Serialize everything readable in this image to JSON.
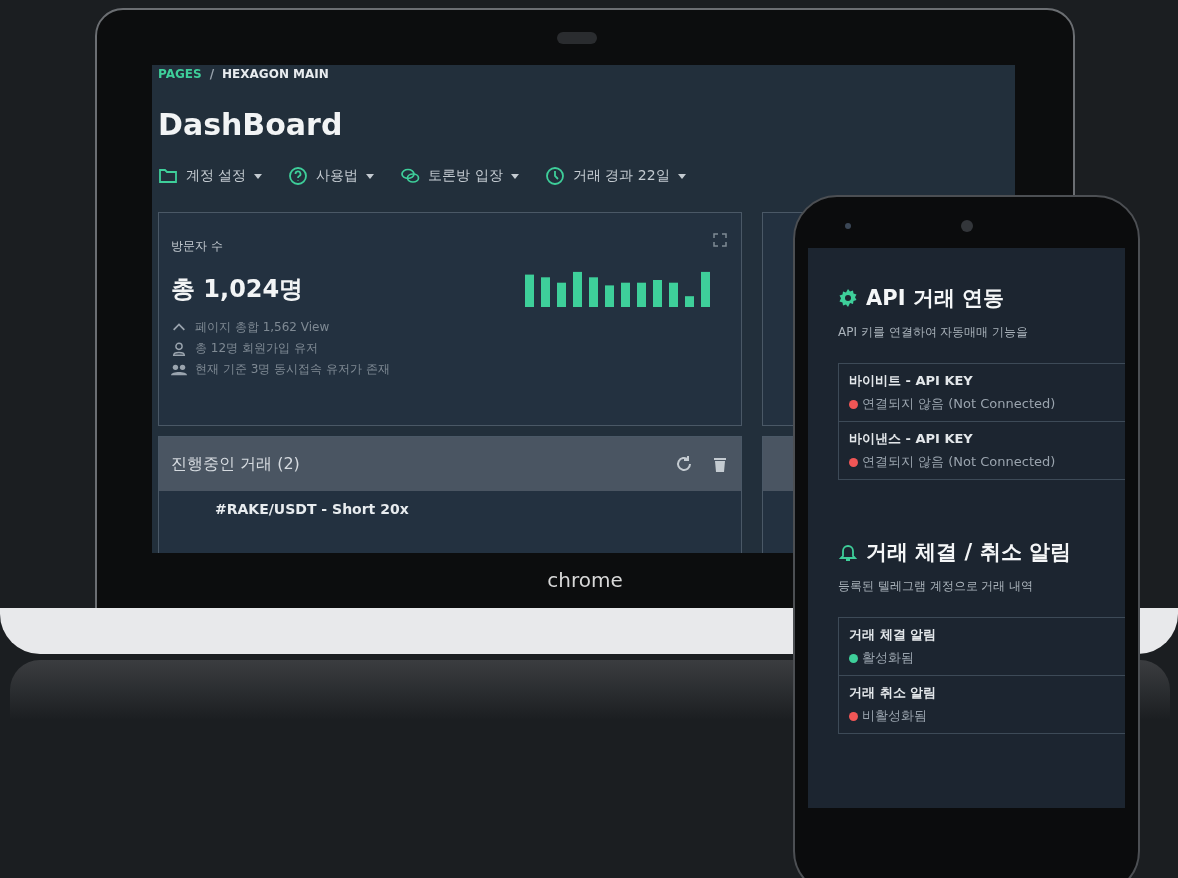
{
  "laptop": {
    "breadcrumb": {
      "section": "PAGES",
      "separator": "/",
      "page": "HEXAGON MAIN"
    },
    "title": "DashBoard",
    "menu": [
      {
        "label": "계정 설정"
      },
      {
        "label": "사용법"
      },
      {
        "label": "토론방 입장"
      },
      {
        "label": "거래 경과 22일"
      }
    ],
    "visitors": {
      "title": "방문자 수",
      "total": "총 1,024명",
      "stats": [
        "페이지 총합 1,562 View",
        "총 12명 회원가입 유저",
        "현재 기준 3명 동시접속 유저가 존재"
      ]
    },
    "trades": {
      "title": "진행중인 거래 (2)",
      "rows": [
        "#RAKE/USDT - Short 20x"
      ]
    },
    "brand": "chrome"
  },
  "phone": {
    "sections": [
      {
        "title": "API 거래 연동",
        "description": "API 키를 연결하여 자동매매 기능을",
        "items": [
          {
            "name": "바이비트 - API KEY",
            "status": "연결되지 않음 (Not Connected)",
            "color": "#f05656"
          },
          {
            "name": "바이낸스 - API KEY",
            "status": "연결되지 않음 (Not Connected)",
            "color": "#f05656"
          }
        ]
      },
      {
        "title": "거래 체결 / 취소 알림",
        "description": "등록된 텔레그램 계정으로 거래 내역",
        "items": [
          {
            "name": "거래 체결 알림",
            "status": "활성화됨",
            "color": "#3ecf9a"
          },
          {
            "name": "거래 취소 알림",
            "status": "비활성화됨",
            "color": "#f05656"
          }
        ]
      }
    ]
  }
}
